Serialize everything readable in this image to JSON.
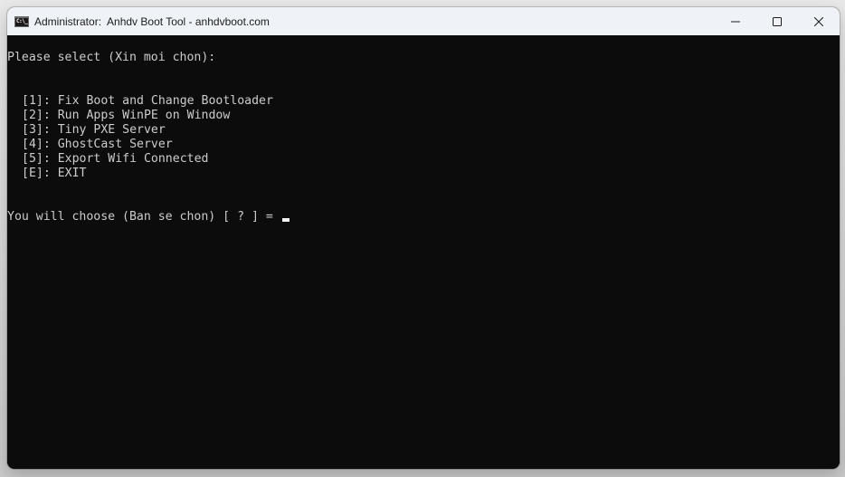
{
  "window": {
    "title": "Administrator:  Anhdv Boot Tool - anhdvboot.com",
    "icon": "console-icon",
    "icon_text": "C:\\_",
    "controls": {
      "minimize": "minimize-icon",
      "maximize": "maximize-icon",
      "close": "close-icon"
    }
  },
  "console": {
    "prompt_header": "Please select (Xin moi chon):",
    "menu": [
      {
        "key": "[1]",
        "label": "Fix Boot and Change Bootloader"
      },
      {
        "key": "[2]",
        "label": "Run Apps WinPE on Window"
      },
      {
        "key": "[3]",
        "label": "Tiny PXE Server"
      },
      {
        "key": "[4]",
        "label": "GhostCast Server"
      },
      {
        "key": "[5]",
        "label": "Export Wifi Connected"
      },
      {
        "key": "[E]",
        "label": "EXIT"
      }
    ],
    "input_prompt": "You will choose (Ban se chon) [ ? ] = ",
    "input_value": ""
  },
  "colors": {
    "console_bg": "#0c0c0c",
    "console_fg": "#cccccc",
    "titlebar_bg": "#eff3f8"
  }
}
